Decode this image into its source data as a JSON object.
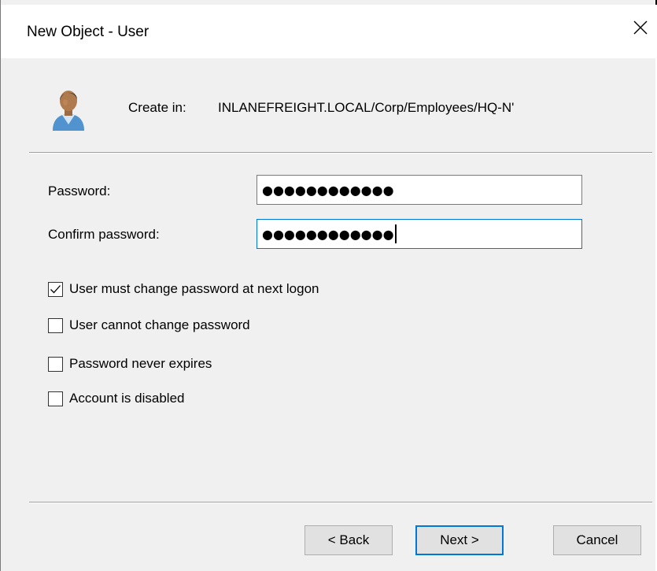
{
  "dialog": {
    "title": "New Object - User",
    "close_glyph": "×"
  },
  "create_in": {
    "label": "Create in:",
    "path": "INLANEFREIGHT.LOCAL/Corp/Employees/HQ-N'"
  },
  "fields": {
    "password": {
      "label": "Password:",
      "masked_value": "●●●●●●●●●●●●"
    },
    "confirm_password": {
      "label": "Confirm password:",
      "masked_value": "●●●●●●●●●●●●"
    }
  },
  "options": [
    {
      "label": "User must change password at next logon",
      "checked": true
    },
    {
      "label": "User cannot change password",
      "checked": false
    },
    {
      "label": "Password never expires",
      "checked": false
    },
    {
      "label": "Account is disabled",
      "checked": false
    }
  ],
  "buttons": {
    "back": "< Back",
    "next": "Next >",
    "cancel": "Cancel"
  },
  "colors": {
    "focus_accent": "#0078d7",
    "dialog_bg": "#f0f0f0",
    "button_bg": "#e1e1e1"
  },
  "icons": {
    "user": "user-icon",
    "close": "close-icon",
    "checkmark": "checkmark-icon"
  }
}
